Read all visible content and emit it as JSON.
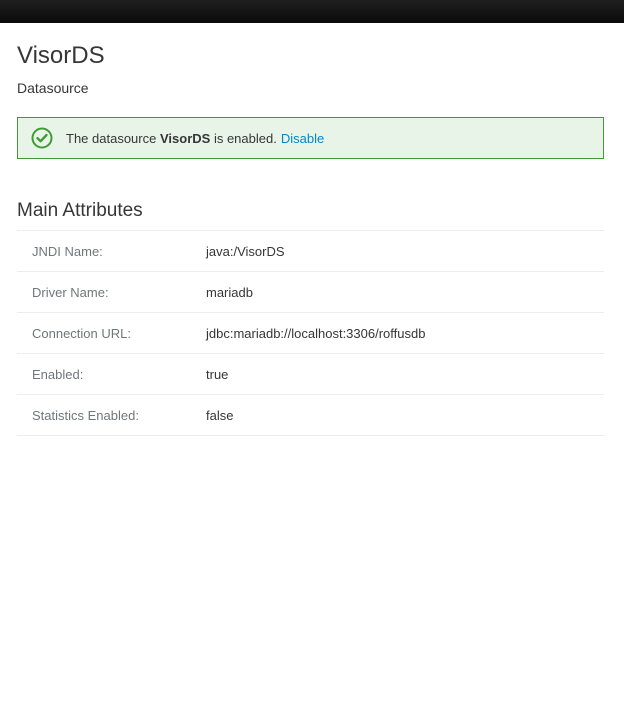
{
  "header": {
    "title": "VisorDS",
    "subtitle": "Datasource"
  },
  "alert": {
    "icon": "check-circle-icon",
    "prefix": "The datasource",
    "name": "VisorDS",
    "suffix": "is enabled.",
    "link_label": "Disable",
    "colors": {
      "border": "#3f9c35",
      "background": "#e9f4e9",
      "link": "#0088ce"
    }
  },
  "main_attributes": {
    "title": "Main Attributes",
    "rows": [
      {
        "label": "JNDI Name:",
        "value": "java:/VisorDS"
      },
      {
        "label": "Driver Name:",
        "value": "mariadb"
      },
      {
        "label": "Connection URL:",
        "value": "jdbc:mariadb://localhost:3306/roffusdb"
      },
      {
        "label": "Enabled:",
        "value": "true"
      },
      {
        "label": "Statistics Enabled:",
        "value": "false"
      }
    ]
  }
}
